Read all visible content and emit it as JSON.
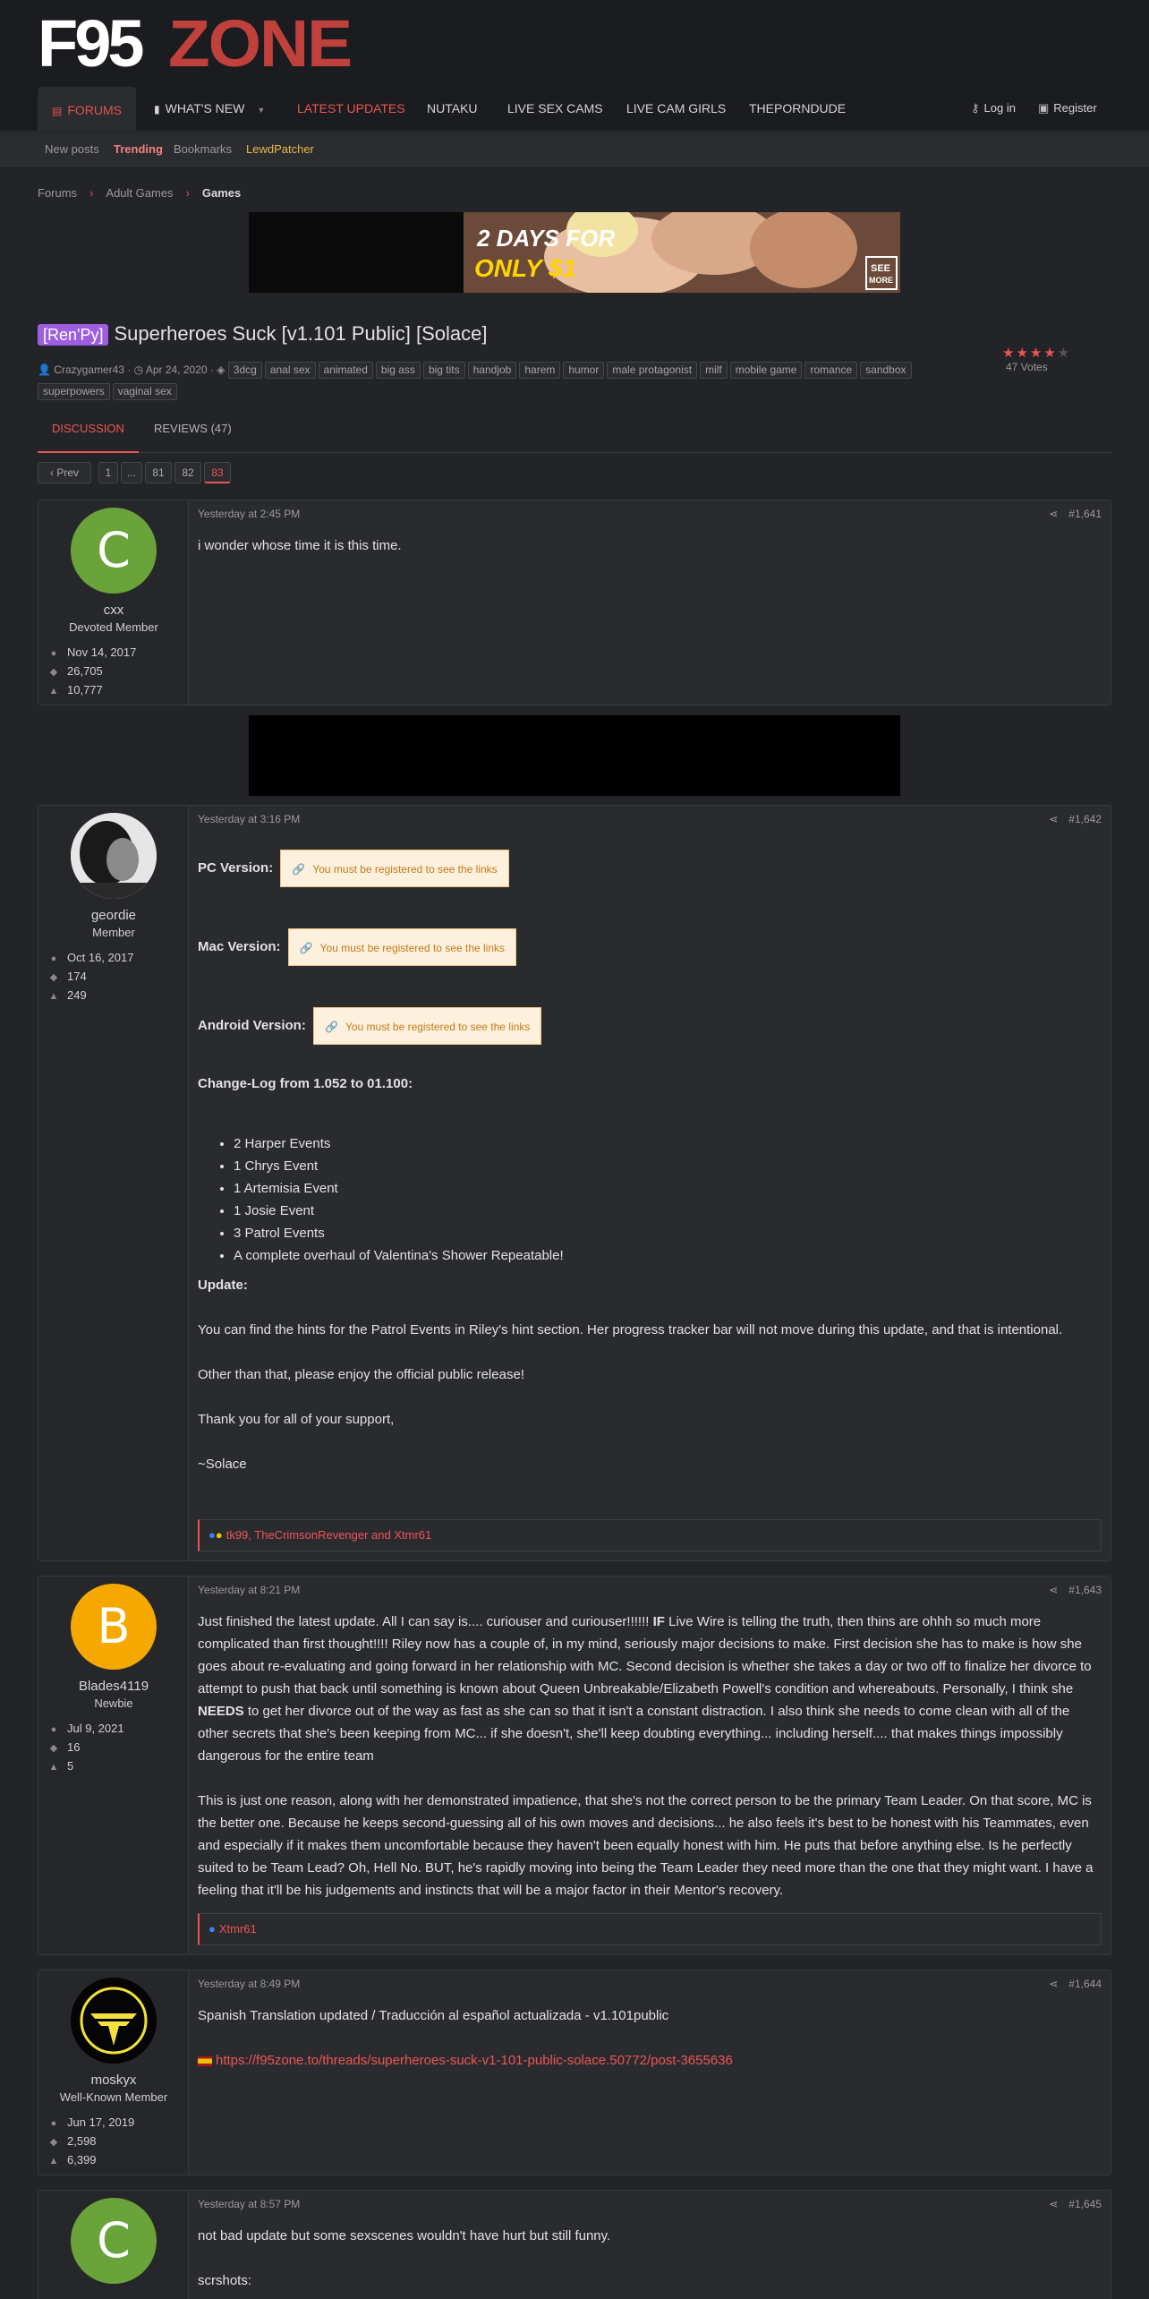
{
  "site": {
    "logo_part1": "F95",
    "logo_part2": "ZONE"
  },
  "nav": {
    "items": [
      "FORUMS",
      "WHAT'S NEW",
      "LATEST UPDATES",
      "NUTAKU",
      "LIVE SEX CAMS",
      "LIVE CAM GIRLS",
      "THEPORNDUDE"
    ],
    "login": "Log in",
    "register": "Register"
  },
  "subnav": {
    "items": [
      "New posts",
      "Trending",
      "Bookmarks",
      "LewdPatcher"
    ]
  },
  "breadcrumb": {
    "items": [
      "Forums",
      "Adult Games",
      "Games"
    ]
  },
  "banner": {
    "line1": "2 DAYS FOR",
    "line2": "ONLY $1",
    "see_more_1": "SEE",
    "see_more_2": "MORE"
  },
  "thread": {
    "prefix": "[Ren'Py]",
    "title": "Superheroes Suck [v1.101 Public] [Solace]",
    "author": "Crazygamer43",
    "date": "Apr 24, 2020",
    "tags": [
      "3dcg",
      "anal sex",
      "animated",
      "big ass",
      "big tits",
      "handjob",
      "harem",
      "humor",
      "male protagonist",
      "milf",
      "mobile game",
      "romance",
      "sandbox",
      "superpowers",
      "vaginal sex"
    ],
    "votes": "47 Votes",
    "rating_stars": 4
  },
  "tabs": {
    "discussion": "DISCUSSION",
    "reviews": "REVIEWS (47)"
  },
  "pager": {
    "prev": "‹ Prev",
    "pages": [
      "1",
      "...",
      "81",
      "82",
      "83"
    ],
    "current": "83"
  },
  "posts": [
    {
      "avatar_letter": "C",
      "avatar_color": "#6aa33a",
      "username": "cxx",
      "user_title": "Devoted Member",
      "joined": "Nov 14, 2017",
      "messages": "26,705",
      "reactions": "10,777",
      "date": "Yesterday at 2:45 PM",
      "number": "#1,641",
      "body": [
        "i wonder whose time it is this time."
      ]
    },
    {
      "username": "geordie",
      "user_title": "Member",
      "joined": "Oct 16, 2017",
      "messages": "174",
      "reactions": "249",
      "date": "Yesterday at 3:16 PM",
      "number": "#1,642",
      "pc_label": "PC Version:",
      "mac_label": "Mac Version:",
      "android_label": "Android Version:",
      "locked_text": "You must be registered to see the links",
      "changelog_title": "Change-Log from 1.052 to 01.100:",
      "changelog": [
        "2 Harper Events",
        "1 Chrys Event",
        "1 Artemisia Event",
        "1 Josie Event",
        "3 Patrol Events",
        "A complete overhaul of Valentina's Shower Repeatable!"
      ],
      "update_title": "Update:",
      "update_paras": [
        "You can find the hints for the Patrol Events in Riley's hint section. Her progress tracker bar will not move during this update, and that is intentional.",
        "Other than that, please enjoy the official public release!",
        "Thank you for all of your support,",
        "~Solace"
      ],
      "reactions_list": "tk99, TheCrimsonRevenger and Xtmr61"
    },
    {
      "avatar_letter": "B",
      "avatar_color": "#f5a800",
      "username": "Blades4119",
      "user_title": "Newbie",
      "joined": "Jul 9, 2021",
      "messages": "16",
      "reactions": "5",
      "date": "Yesterday at 8:21 PM",
      "number": "#1,643",
      "p1_a": "Just finished the latest update. All I can say is.... curiouser and curiouser!!!!!! ",
      "p1_if": "IF",
      "p1_b": " Live Wire is telling the truth, then thins are ohhh so much more complicated than first thought!!!! Riley now has a couple of, in my mind, seriously major decisions to make. First decision she has to make is how she goes about re-evaluating and going forward in her relationship with MC. Second decision is whether she takes a day or two off to finalize her divorce to attempt to push that back until something is known about Queen Unbreakable/Elizabeth Powell's condition and whereabouts. Personally, I think she ",
      "p1_needs": "NEEDS",
      "p1_c": " to get her divorce out of the way as fast as she can so that it isn't a constant distraction. I also think she needs to come clean with all of the other secrets that she's been keeping from MC... if she doesn't, she'll keep doubting everything... including herself.... that makes things impossibly dangerous for the entire team",
      "p2": "This is just one reason, along with her demonstrated impatience, that she's not the correct person to be the primary Team Leader. On that score, MC is the better one. Because he keeps second-guessing all of his own moves and decisions... he also feels it's best to be honest with his Teammates, even and especially if it makes them uncomfortable because they haven't been equally honest with him. He puts that before anything else. Is he perfectly suited to be Team Lead? Oh, Hell No. BUT, he's rapidly moving into being the Team Leader they need more than the one that they might want. I have a feeling that it'll be his judgements and instincts that will be a major factor in their Mentor's recovery.",
      "reactions_list": "Xtmr61"
    },
    {
      "username": "moskyx",
      "user_title": "Well-Known Member",
      "joined": "Jun 17, 2019",
      "messages": "2,598",
      "reactions": "6,399",
      "date": "Yesterday at 8:49 PM",
      "number": "#1,644",
      "line1": "Spanish Translation updated / Traducción al español actualizada - v1.101public",
      "link": "https://f95zone.to/threads/superheroes-suck-v1-101-public-solace.50772/post-3655636"
    },
    {
      "avatar_letter": "C",
      "avatar_color": "#6aa33a",
      "date": "Yesterday at 8:57 PM",
      "number": "#1,645",
      "line1": "not bad update but some sexscenes wouldn't have hurt but still funny.",
      "line2": "scrshots:"
    }
  ],
  "colors": {
    "accent": "#ec5555",
    "bg": "#232427",
    "panel": "#2a2b2f"
  }
}
